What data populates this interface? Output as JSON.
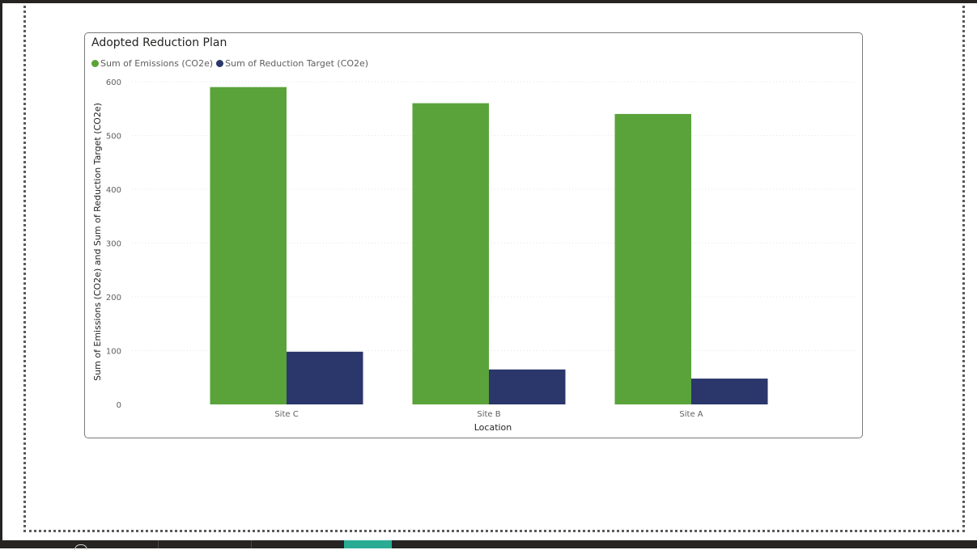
{
  "canvas": {
    "bottom_tabs": [
      {
        "label": "",
        "active": false
      },
      {
        "label": "",
        "active": false
      },
      {
        "label": "",
        "active": false
      },
      {
        "label": "",
        "active": true
      }
    ]
  },
  "visual": {
    "title": "Adopted Reduction Plan"
  },
  "chart_data": {
    "type": "bar",
    "title": "Adopted Reduction Plan",
    "xlabel": "Location",
    "ylabel": "Sum of Emissions (CO2e) and Sum of Reduction Target (CO2e)",
    "categories": [
      "Site C",
      "Site B",
      "Site A"
    ],
    "series": [
      {
        "name": "Sum of Emissions (CO2e)",
        "color": "#5aa33a",
        "values": [
          590,
          560,
          540
        ]
      },
      {
        "name": "Sum of Reduction Target (CO2e)",
        "color": "#2b366b",
        "values": [
          98,
          65,
          48
        ]
      }
    ],
    "ylim": [
      0,
      600
    ],
    "yticks": [
      0,
      100,
      200,
      300,
      400,
      500,
      600
    ],
    "grid": true,
    "legend": "top-left"
  }
}
